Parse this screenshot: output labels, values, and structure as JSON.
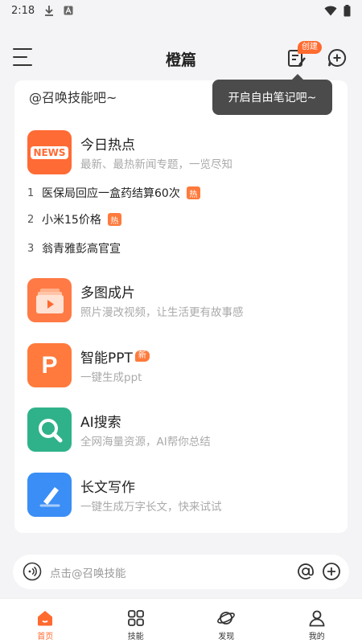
{
  "status_bar": {
    "time": "2:18"
  },
  "header": {
    "title": "橙篇",
    "create_badge": "创建"
  },
  "card": {
    "prompt": "@召唤技能吧~"
  },
  "tooltip": {
    "text": "开启自由笔记吧~"
  },
  "hot_topics": {
    "title": "今日热点",
    "description": "最新、最热新闻专题，一览尽知",
    "icon_text": "NEWS",
    "items": [
      {
        "rank": "1",
        "text": "医保局回应一盒药结算60次",
        "badge": "热"
      },
      {
        "rank": "2",
        "text": "小米15价格",
        "badge": "热"
      },
      {
        "rank": "3",
        "text": "翁青雅彭高官宣",
        "badge": ""
      }
    ]
  },
  "skills": [
    {
      "title": "多图成片",
      "description": "照片漫改视频，让生活更有故事感",
      "icon": "video-collage-icon",
      "badge": ""
    },
    {
      "title": "智能PPT",
      "description": "一键生成ppt",
      "icon": "ppt-icon",
      "badge": "新"
    },
    {
      "title": "AI搜索",
      "description": "全网海量资源，AI帮你总结",
      "icon": "search-icon",
      "badge": ""
    },
    {
      "title": "长文写作",
      "description": "一键生成万字长文，快来试试",
      "icon": "pen-icon",
      "badge": ""
    }
  ],
  "input": {
    "placeholder": "点击@召唤技能"
  },
  "tabs": [
    {
      "label": "首页",
      "icon": "home-icon",
      "active": true
    },
    {
      "label": "技能",
      "icon": "grid-icon",
      "active": false
    },
    {
      "label": "发现",
      "icon": "planet-icon",
      "active": false
    },
    {
      "label": "我的",
      "icon": "user-icon",
      "active": false
    }
  ],
  "colors": {
    "accent": "#ff6a2f",
    "news": "#ff6b35",
    "ppt": "#ff7a3c",
    "search": "#2fb28a",
    "writing": "#3a8ef5"
  }
}
